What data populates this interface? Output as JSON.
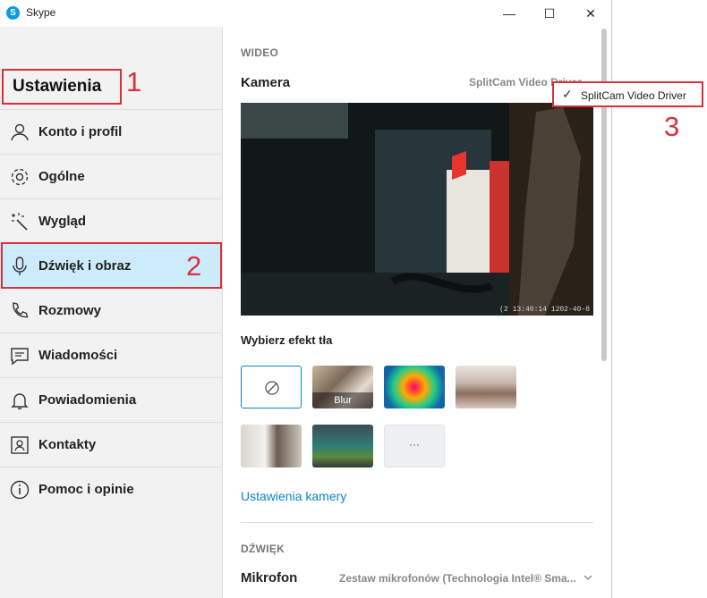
{
  "window": {
    "title": "Skype",
    "minimize": "—",
    "maximize": "☐",
    "close": "✕"
  },
  "sidebar": {
    "title": "Ustawienia",
    "items": [
      {
        "label": "Konto i profil"
      },
      {
        "label": "Ogólne"
      },
      {
        "label": "Wygląd"
      },
      {
        "label": "Dźwięk i obraz"
      },
      {
        "label": "Rozmowy"
      },
      {
        "label": "Wiadomości"
      },
      {
        "label": "Powiadomienia"
      },
      {
        "label": "Kontakty"
      },
      {
        "label": "Pomoc i opinie"
      }
    ]
  },
  "annotations": {
    "n1": "1",
    "n2": "2",
    "n3": "3"
  },
  "video": {
    "section": "WIDEO",
    "camera_label": "Kamera",
    "camera_device": "SplitCam Video Driver",
    "overlay_timestamp": "(2 13:40:14  1202-40-8",
    "bg_effect_label": "Wybierz efekt tła",
    "effects": [
      {
        "label": "",
        "kind": "none"
      },
      {
        "label": "Blur",
        "kind": "blur"
      },
      {
        "label": "",
        "kind": "colorful"
      },
      {
        "label": "",
        "kind": "room"
      },
      {
        "label": "",
        "kind": "office"
      },
      {
        "label": "",
        "kind": "hall"
      },
      {
        "label": "···",
        "kind": "more"
      }
    ],
    "camera_settings_link": "Ustawienia kamery"
  },
  "dropdown": {
    "selected": "SplitCam Video Driver",
    "check": "✓"
  },
  "audio": {
    "section": "DŹWIĘK",
    "mic_label": "Mikrofon",
    "mic_device": "Zestaw mikrofonów (Technologia Intel® Sma..."
  },
  "colors": {
    "accent": "#0a85c8",
    "active_bg": "#ccebfb",
    "annotation_red": "#d9303a"
  }
}
